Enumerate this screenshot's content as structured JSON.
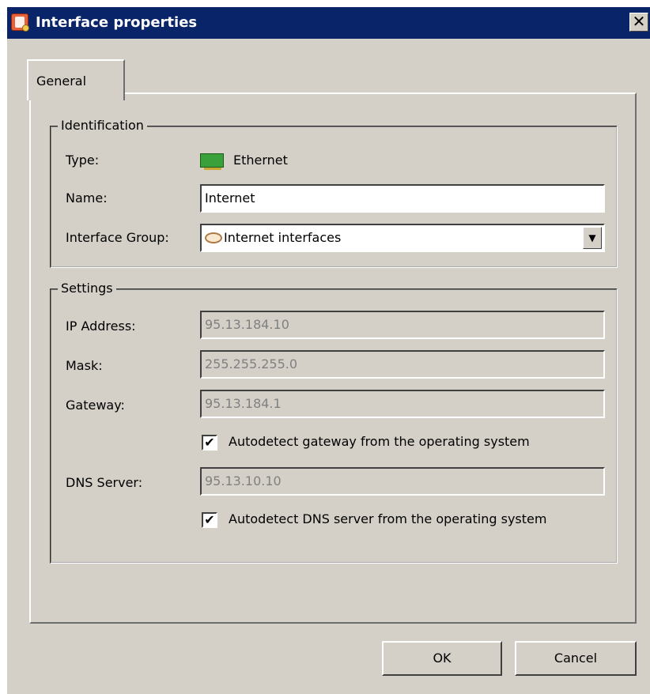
{
  "window": {
    "title": "Interface properties",
    "close_symbol": "✕"
  },
  "tabs": [
    {
      "label": "General"
    }
  ],
  "identification": {
    "legend": "Identification",
    "type_label": "Type:",
    "type_value": "Ethernet",
    "name_label": "Name:",
    "name_value": "Internet",
    "group_label": "Interface Group:",
    "group_value": "Internet interfaces"
  },
  "settings": {
    "legend": "Settings",
    "ip_label": "IP Address:",
    "ip_value": "95.13.184.10",
    "mask_label": "Mask:",
    "mask_value": "255.255.255.0",
    "gateway_label": "Gateway:",
    "gateway_value": "95.13.184.1",
    "auto_gateway_label": "Autodetect gateway from the operating system",
    "auto_gateway_checked": true,
    "dns_label": "DNS Server:",
    "dns_value": "95.13.10.10",
    "auto_dns_label": "Autodetect DNS server from the operating system",
    "auto_dns_checked": true
  },
  "buttons": {
    "ok": "OK",
    "cancel": "Cancel"
  },
  "icons": {
    "app": "app-icon",
    "close": "close-icon",
    "nic": "network-card-icon",
    "group": "interface-group-icon",
    "dropdown": "chevron-down-icon",
    "check": "checkmark-icon"
  },
  "colors": {
    "titlebar": "#0a246a",
    "window_bg": "#d4d0c8"
  }
}
